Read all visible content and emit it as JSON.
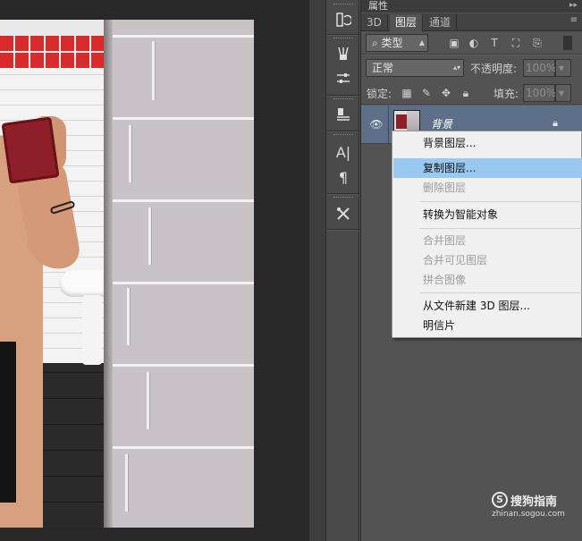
{
  "panel": {
    "title": "属性",
    "tabs": [
      {
        "label": "3D",
        "active": false
      },
      {
        "label": "图层",
        "active": true
      },
      {
        "label": "通道",
        "active": false
      }
    ],
    "filter": {
      "kind_label": "类型",
      "icons": [
        "image-filter-icon",
        "adjustment-filter-icon",
        "type-filter-icon",
        "shape-filter-icon",
        "smart-object-filter-icon"
      ]
    },
    "blend_mode": "正常",
    "opacity": {
      "label": "不透明度:",
      "value": "100%"
    },
    "lock": {
      "label": "锁定:",
      "icons": [
        "lock-transparent-pixels-icon",
        "lock-image-pixels-icon",
        "lock-position-icon",
        "lock-all-icon"
      ]
    },
    "fill": {
      "label": "填充:",
      "value": "100%"
    },
    "layer": {
      "name": "背景",
      "visible": true,
      "locked": true
    }
  },
  "context_menu": {
    "items": [
      {
        "label": "背景图层...",
        "enabled": true,
        "highlighted": false
      },
      {
        "label": "复制图层...",
        "enabled": true,
        "highlighted": true
      },
      {
        "label": "删除图层",
        "enabled": false,
        "highlighted": false
      },
      {
        "label": "转换为智能对象",
        "enabled": true,
        "highlighted": false
      },
      {
        "label": "合并图层",
        "enabled": false,
        "highlighted": false
      },
      {
        "label": "合并可见图层",
        "enabled": false,
        "highlighted": false
      },
      {
        "label": "拼合图像",
        "enabled": false,
        "highlighted": false
      },
      {
        "label": "从文件新建 3D 图层...",
        "enabled": true,
        "highlighted": false
      },
      {
        "label": "明信片",
        "enabled": true,
        "highlighted": false
      }
    ]
  },
  "toolstrip": {
    "icons": [
      "history-icon",
      "brush-presets-icon",
      "adjustments-icon",
      "clone-source-icon",
      "character-icon",
      "paragraph-icon",
      "tool-presets-icon"
    ]
  },
  "watermark": {
    "logo_glyph": "S",
    "title": "搜狗指南",
    "url": "zhinan.sogou.com"
  },
  "colors": {
    "panel_bg": "#535353",
    "selected_layer": "#5d6f88",
    "menu_highlight": "#99c9f1"
  }
}
